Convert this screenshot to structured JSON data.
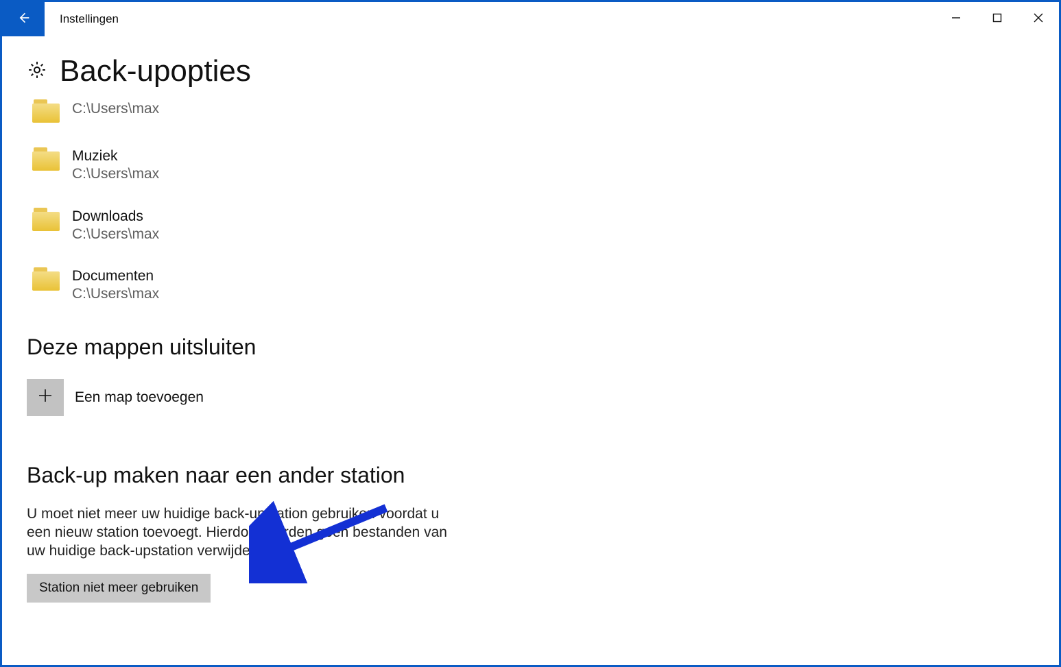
{
  "titlebar": {
    "title": "Instellingen"
  },
  "page": {
    "title": "Back-upopties"
  },
  "folders": [
    {
      "name": "",
      "path": "C:\\Users\\max"
    },
    {
      "name": "Muziek",
      "path": "C:\\Users\\max"
    },
    {
      "name": "Downloads",
      "path": "C:\\Users\\max"
    },
    {
      "name": "Documenten",
      "path": "C:\\Users\\max"
    }
  ],
  "exclude_section": {
    "heading": "Deze mappen uitsluiten",
    "add_label": "Een map toevoegen"
  },
  "other_drive_section": {
    "heading": "Back-up maken naar een ander station",
    "description": "U moet niet meer uw huidige back-upstation gebruiken voordat u een nieuw station toevoegt. Hierdoor worden geen bestanden van uw huidige back-upstation verwijderd",
    "button_label": "Station niet meer gebruiken"
  }
}
